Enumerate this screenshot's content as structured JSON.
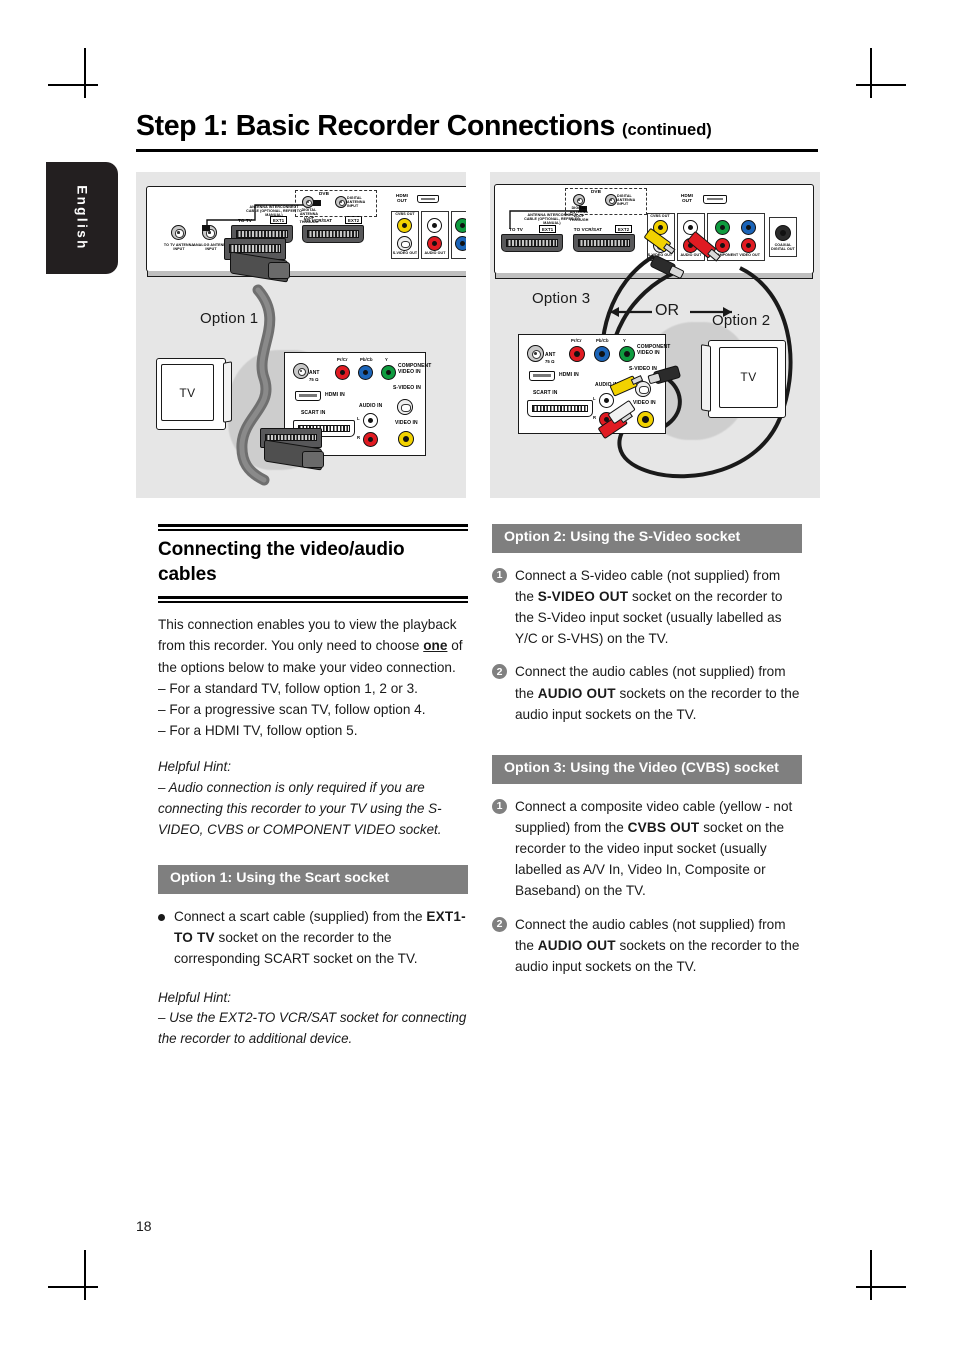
{
  "page": {
    "number": "18",
    "language_tab": "English",
    "title": "Step 1: Basic Recorder Connections",
    "title_suffix": "(continued)"
  },
  "figures": {
    "left": {
      "option_label": "Option 1",
      "tv_label": "TV",
      "recorder_labels": {
        "to_tv_antenna_input": "TO TV ANTENNA INPUT",
        "analog_antenna_input": "ANALOG ANTENNA INPUT",
        "antenna_interconnect": "ANTENNA INTERCONNECT CABLE (OPTIONAL, REFER TO MANUAL)",
        "to_tv": "TO TV",
        "ext1": "EXT1",
        "to_vcr_sat": "TO VCR/SAT",
        "ext2": "EXT2",
        "dvb": "DVB",
        "digital_antenna_loop": "DIGITAL ANTENNA LOOP THROUGH",
        "digital_antenna_input": "DIGITAL ANTENNA INPUT",
        "hdmi_out": "HDMI OUT",
        "cvbs_out": "CVBS OUT",
        "s_video_out": "S-VIDEO OUT",
        "audio_out": "AUDIO OUT"
      },
      "tv_panel_labels": {
        "ant": "ANT",
        "ant_ohm": "75 Ω",
        "pr_cr": "Pr/Cr",
        "pb_cb": "Pb/Cb",
        "y": "Y",
        "component_video_in": "COMPONENT VIDEO IN",
        "hdmi_in": "HDMI IN",
        "s_video_in": "S-VIDEO IN",
        "scart_in": "SCART IN",
        "audio_in": "AUDIO IN",
        "audio_l": "L",
        "audio_r": "R",
        "video_in": "VIDEO IN"
      }
    },
    "right": {
      "option_left_label": "Option 3",
      "option_right_label": "Option 2",
      "or_label": "OR",
      "tv_label": "TV",
      "recorder_labels": {
        "antenna_interconnect": "ANTENNA INTERCONNECT CABLE (OPTIONAL, REFER TO MANUAL)",
        "to_tv": "TO TV",
        "ext1": "EXT1",
        "to_vcr_sat": "TO VCR/SAT",
        "ext2": "EXT2",
        "dvb": "DVB",
        "digital_antenna_loop": "DIGITAL ANTENNA LOOP THROUGH",
        "digital_antenna_input": "DIGITAL ANTENNA INPUT",
        "hdmi_out": "HDMI OUT",
        "cvbs_out": "CVBS OUT",
        "s_video_out": "S-VIDEO OUT",
        "audio_out": "AUDIO OUT",
        "component_video_out": "COMPONENT VIDEO OUT",
        "coaxial_digital_out": "COAXIAL DIGITAL OUT"
      },
      "tv_panel_labels": {
        "ant": "ANT",
        "ant_ohm": "75 Ω",
        "pr_cr": "Pr/Cr",
        "pb_cb": "Pb/Cb",
        "y": "Y",
        "component_video_in": "COMPONENT VIDEO IN",
        "hdmi_in": "HDMI IN",
        "s_video_in": "S-VIDEO IN",
        "scart_in": "SCART IN",
        "audio_in": "AUDIO IN",
        "audio_l": "L",
        "audio_r": "R",
        "video_in": "VIDEO IN"
      }
    }
  },
  "left_column": {
    "heading": "Connecting the video/audio cables",
    "intro_1": "This connection enables you to view the playback from this recorder. You only need to choose ",
    "intro_emphasis": "one",
    "intro_2": " of the options below to make your video connection.",
    "dash_items": [
      "–   For a standard TV, follow option 1, 2 or 3.",
      "–   For a progressive scan TV, follow option 4.",
      "–   For a HDMI TV, follow option 5."
    ],
    "hint_label": "Helpful Hint:",
    "hint_text": "–  Audio connection is only required if you are connecting this recorder to your TV using the S-VIDEO, CVBS or COMPONENT VIDEO socket.",
    "option1": {
      "header": "Option 1: Using the Scart socket",
      "body_1": "Connect a scart cable (supplied) from the ",
      "body_strong": "EXT1-TO TV",
      "body_2": " socket on the recorder to the corresponding SCART socket on the TV.",
      "hint_label": "Helpful Hint:",
      "hint_text": "–  Use the EXT2-TO VCR/SAT socket for connecting the recorder to additional device."
    }
  },
  "right_column": {
    "option2": {
      "header": "Option 2: Using the S-Video socket",
      "steps": [
        {
          "num": "1",
          "part_1": "Connect a S-video cable (not supplied) from the ",
          "strong": "S-VIDEO OUT",
          "part_2": " socket on the recorder to the S-Video input socket (usually labelled as Y/C or S-VHS) on the TV."
        },
        {
          "num": "2",
          "part_1": "Connect the audio cables (not supplied) from the ",
          "strong": "AUDIO OUT",
          "part_2": " sockets on the recorder to the audio input sockets on the TV."
        }
      ]
    },
    "option3": {
      "header": "Option 3: Using the Video (CVBS) socket",
      "steps": [
        {
          "num": "1",
          "part_1": "Connect a composite video cable (yellow - not supplied) from the ",
          "strong": "CVBS OUT",
          "part_2": " socket on the recorder to the video input socket (usually labelled as A/V In, Video In, Composite or Baseband) on the TV."
        },
        {
          "num": "2",
          "part_1": "Connect the audio cables (not supplied) from the ",
          "strong": "AUDIO OUT",
          "part_2": " sockets on the recorder to the audio input sockets on the TV."
        }
      ]
    }
  },
  "colors": {
    "header_bar": "#7f7f7f",
    "figure_bg": "#e6e6e6",
    "tab_bg": "#231f20",
    "yellow": "#f2d200",
    "red": "#e01b22",
    "blue": "#1b64b8",
    "green": "#0f9b3f"
  }
}
